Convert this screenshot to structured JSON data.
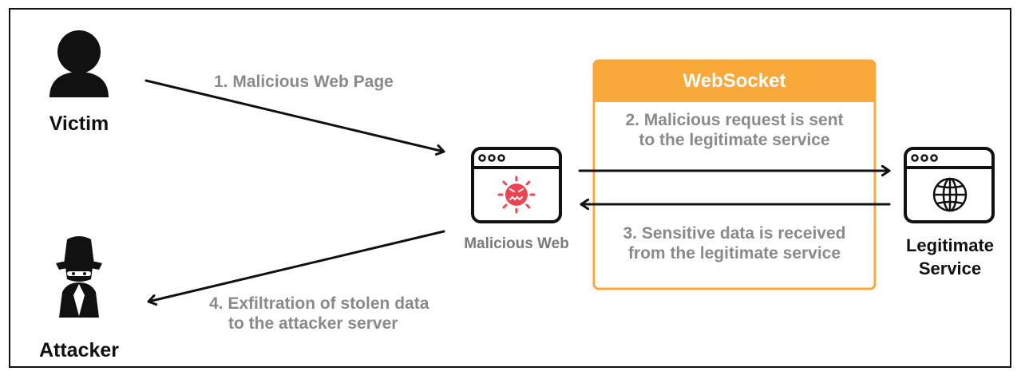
{
  "diagram": {
    "victim_label": "Victim",
    "attacker_label": "Attacker",
    "malicious_web_label": "Malicious Web",
    "legitimate_service_label": [
      "Legitimate",
      "Service"
    ],
    "websocket_title": "WebSocket",
    "steps": {
      "step1": "1. Malicious Web Page",
      "step2": [
        "2. Malicious request is sent",
        "to the legitimate service"
      ],
      "step3": [
        "3. Sensitive data is received",
        "from the legitimate service"
      ],
      "step4": [
        "4. Exfiltration of stolen data",
        "to the attacker server"
      ]
    }
  },
  "colors": {
    "websocket_accent": "#f9a93a",
    "virus_red": "#ec4450",
    "step_text": "#8a8a8a",
    "ink": "#111111"
  },
  "icons": {
    "victim": "person-silhouette-icon",
    "attacker": "spy-icon",
    "malicious_web": "browser-virus-icon",
    "legitimate_service": "browser-globe-icon"
  }
}
